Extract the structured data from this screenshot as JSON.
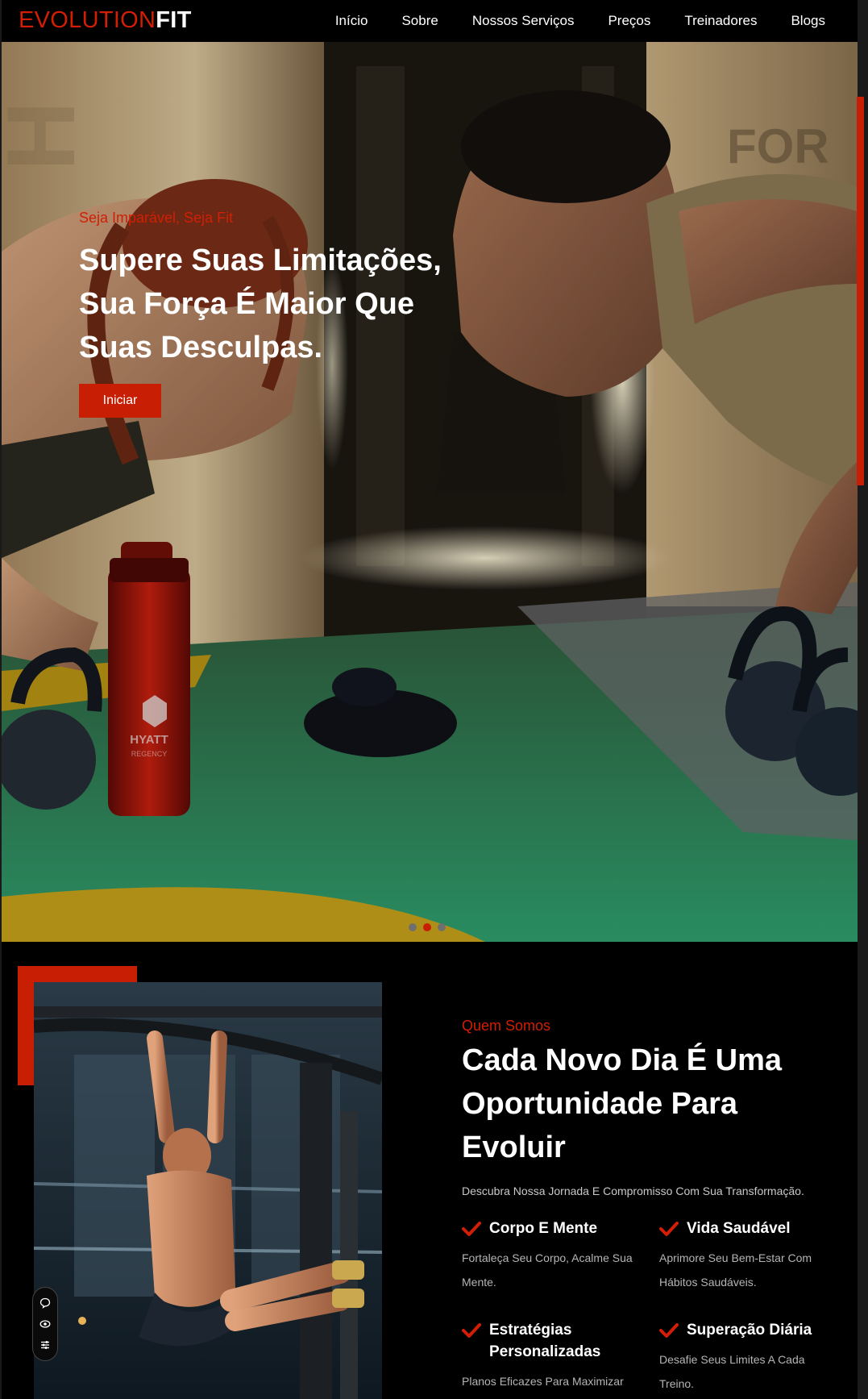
{
  "brand": {
    "part1": "EVOLUTION",
    "part2": "FIT"
  },
  "nav": {
    "items": [
      "Início",
      "Sobre",
      "Nossos Serviços",
      "Preços",
      "Treinadores",
      "Blogs"
    ]
  },
  "hero": {
    "tagline": "Seja Imparável, Seja Fit",
    "title": "Supere Suas Limitações, Sua Força É Maior Que Suas Desculpas.",
    "button": "Iniciar",
    "bottle_label": "HYATT",
    "bottle_sublabel": "REGENCY",
    "carousel": {
      "slides": 3,
      "active_index": 1
    }
  },
  "about": {
    "tagline": "Quem Somos",
    "title": "Cada Novo Dia É Uma Oportunidade Para Evoluir",
    "description": "Descubra Nossa Jornada E Compromisso Com Sua Transformação.",
    "features": [
      {
        "title": "Corpo E Mente",
        "text": "Fortaleça Seu Corpo, Acalme Sua Mente."
      },
      {
        "title": "Vida Saudável",
        "text": "Aprimore Seu Bem-Estar Com Hábitos Saudáveis."
      },
      {
        "title": "Estratégias Personalizadas",
        "text": "Planos Eficazes Para Maximizar"
      },
      {
        "title": "Superação Diária",
        "text": "Desafie Seus Limites A Cada Treino."
      }
    ]
  },
  "widget": {
    "icons": [
      "chat-icon",
      "eye-icon",
      "sliders-icon"
    ]
  },
  "colors": {
    "accent": "#c81e04",
    "background": "#000000",
    "text": "#ffffff"
  }
}
